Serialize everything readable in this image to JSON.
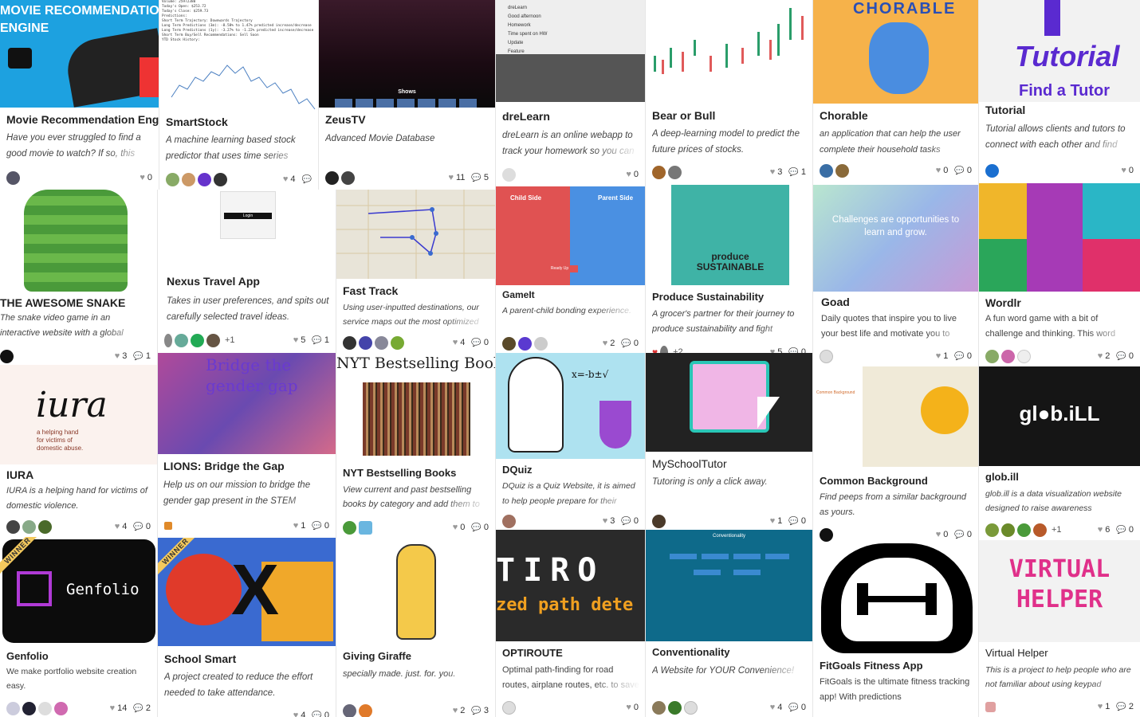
{
  "cards": [
    {
      "id": "movie",
      "title": "Movie Recommendation Engine",
      "desc": "Have you ever struggled to find a good movie to watch? If so, this web",
      "likes": "0",
      "comments": "",
      "thumb_text": "MOVIE RECOMMENDATION\nENGINE",
      "accent": "#1da1e0"
    },
    {
      "id": "smartstock",
      "title": "SmartStock",
      "desc": "A machine learning based stock predictor that uses time series",
      "likes": "4",
      "comments": "",
      "thumb_text": "Volume: 25972380\nToday's Open: $253.72\nToday's Close: $259.73\nPredictions:\nShort Term Trajectory: Downwards Trajectory\nLong Term Predictions (3m): -8.58% to 1.47% predicted increase/decrease\nLong Term Predictions (1y): -3.27% to -1.22% predicted increase/decrease\nShort Term Buy/Sell Recommendations: Sell Soon\nYTD Stock History:"
    },
    {
      "id": "zeustv",
      "title": "ZeusTV",
      "desc": "Advanced Movie Database",
      "likes": "11",
      "comments": "5",
      "thumb_text": "Shows"
    },
    {
      "id": "drelearn",
      "title": "dreLearn",
      "desc": "dreLearn is an online webapp to track your homework so you can",
      "likes": "0",
      "comments": "",
      "thumb_text": "dreLearn\nGood afternoon\nHomework\nTime spent on HW\nUpdate\nFeature"
    },
    {
      "id": "bearbull",
      "title": "Bear or Bull",
      "desc": "A deep-learning model to predict the future prices of stocks.",
      "likes": "3",
      "comments": "1"
    },
    {
      "id": "chorable",
      "title": "Chorable",
      "desc": "an application that can help the user complete their household tasks",
      "likes": "0",
      "comments": "0",
      "thumb_text": "CHORABLE"
    },
    {
      "id": "tutorial",
      "title": "Tutorial",
      "desc": "Tutorial allows clients and tutors to connect with each other and find",
      "likes": "0",
      "comments": "",
      "thumb_text": "Tutorial",
      "thumb_sub": "Find a Tutor"
    },
    {
      "id": "snake",
      "title": "THE AWESOME SNAKE",
      "desc": "The snake video game in an interactive website with a global",
      "likes": "3",
      "comments": "1"
    },
    {
      "id": "nexus",
      "title": "Nexus Travel App",
      "desc": "Takes in user preferences, and spits out carefully selected travel ideas.",
      "likes": "5",
      "comments": "1",
      "avatars_plus": "+1",
      "thumb_text": "Login"
    },
    {
      "id": "fasttrack",
      "title": "Fast Track",
      "desc": "Using user-inputted destinations, our service maps out the most optimized",
      "likes": "4",
      "comments": "0"
    },
    {
      "id": "gameit",
      "title": "GameIt",
      "desc": "A parent-child bonding experience.",
      "likes": "2",
      "comments": "0",
      "thumb_left": "Child Side",
      "thumb_right": "Parent Side",
      "thumb_btn": "Ready Up"
    },
    {
      "id": "produce",
      "title": "Produce Sustainability",
      "desc": "A grocer's partner for their journey to produce sustainability and fight",
      "likes": "5",
      "comments": "0",
      "avatars_plus": "+2",
      "thumb_text": "produce\nSUSTAINABLE"
    },
    {
      "id": "goad",
      "title": "Goad",
      "desc": "Daily quotes that inspire you to live your best life and motivate you to",
      "likes": "1",
      "comments": "0",
      "thumb_text": "Challenges are opportunities to learn and grow."
    },
    {
      "id": "wordlr",
      "title": "Wordlr",
      "desc": "A fun word game with a bit of challenge and thinking. This word",
      "likes": "2",
      "comments": "0"
    },
    {
      "id": "iura",
      "title": "IURA",
      "desc": "IURA is a helping hand for victims of domestic violence.",
      "likes": "4",
      "comments": "0",
      "thumb_text": "iura",
      "thumb_sub": "a helping hand\nfor victims of\ndomestic abuse."
    },
    {
      "id": "lions",
      "title": "LIONS: Bridge the Gap",
      "desc": "Help us on our mission to bridge the gender gap present in the STEM",
      "likes": "1",
      "comments": "0",
      "thumb_text": "Bridge the\ngender gap"
    },
    {
      "id": "nyt",
      "title": "NYT Bestselling Books",
      "desc": "View current and past bestselling books by category and add them to",
      "likes": "0",
      "comments": "0",
      "thumb_text": "NYT Bestselling Books"
    },
    {
      "id": "dquiz",
      "title": "DQuiz",
      "desc": "DQuiz is a Quiz Website, it is aimed to help people prepare for their",
      "likes": "3",
      "comments": "0"
    },
    {
      "id": "myschooltutor",
      "title": "MySchoolTutor",
      "desc": "Tutoring is only a click away.",
      "likes": "1",
      "comments": "0"
    },
    {
      "id": "commonbg",
      "title": "Common Background",
      "desc": "Find peeps from a similar background as yours.",
      "likes": "0",
      "comments": "0",
      "thumb_text": "Common Background"
    },
    {
      "id": "globill",
      "title": "glob.ill",
      "desc": "glob.ill is a data visualization website designed to raise awareness",
      "likes": "6",
      "comments": "0",
      "avatars_plus": "+1",
      "thumb_text": "gl●b.iLL"
    },
    {
      "id": "genfolio",
      "title": "Genfolio",
      "desc": "We make portfolio website creation easy.",
      "likes": "14",
      "comments": "2",
      "winner": "WINNER",
      "thumb_text": "Genfolio"
    },
    {
      "id": "schoolsmart",
      "title": "School Smart",
      "desc": "A project created to reduce the effort needed to take attendance.",
      "likes": "4",
      "comments": "0",
      "winner": "WINNER"
    },
    {
      "id": "giraffe",
      "title": "Giving Giraffe",
      "desc": "specially made. just. for. you.",
      "likes": "2",
      "comments": "3"
    },
    {
      "id": "optiroute",
      "title": "OPTIROUTE",
      "desc": "Optimal path-finding for road routes, airplane routes, etc. to save energy",
      "likes": "0",
      "comments": "",
      "thumb_text": "TIRO",
      "thumb_sub": "zed path dete"
    },
    {
      "id": "conventionality",
      "title": "Conventionality",
      "desc": "A Website for YOUR Convenience!",
      "likes": "4",
      "comments": "0",
      "thumb_text": "Conventionality"
    },
    {
      "id": "fitgoals",
      "title": "FitGoals Fitness App",
      "desc": "FitGoals is the ultimate fitness tracking app! With predictions",
      "likes": "",
      "comments": ""
    },
    {
      "id": "virtualhelper",
      "title": "Virtual Helper",
      "desc": "This is a project to help people who are not familiar about using keypad",
      "likes": "1",
      "comments": "2",
      "thumb_text": "VIRTUAL\nHELPER"
    }
  ]
}
